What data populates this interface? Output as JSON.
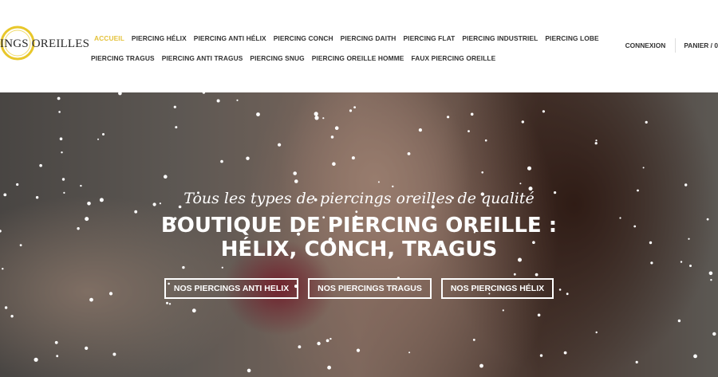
{
  "logo": {
    "text": "INGS OREILLES"
  },
  "nav": {
    "row1": [
      "ACCUEIL",
      "PIERCING HÉLIX",
      "PIERCING ANTI HÉLIX",
      "PIERCING CONCH",
      "PIERCING DAITH",
      "PIERCING FLAT",
      "PIERCING INDUSTRIEL",
      "PIERCING LOBE"
    ],
    "row2": [
      "PIERCING TRAGUS",
      "PIERCING ANTI TRAGUS",
      "PIERCING SNUG",
      "PIERCING OREILLE HOMME",
      "FAUX PIERCING OREILLE"
    ],
    "active_color": "#e4c23a"
  },
  "account": {
    "login": "CONNEXION",
    "cart": "PANIER / 0"
  },
  "hero": {
    "subtitle": "Tous les types de piercings oreilles de qualité",
    "title_line1": "BOUTIQUE DE PIERCING OREILLE :",
    "title_line2": "HÉLIX, CONCH, TRAGUS",
    "buttons": [
      "NOS PIERCINGS ANTI HELIX",
      "NOS PIERCINGS TRAGUS",
      "NOS PIERCINGS HÉLIX"
    ]
  }
}
